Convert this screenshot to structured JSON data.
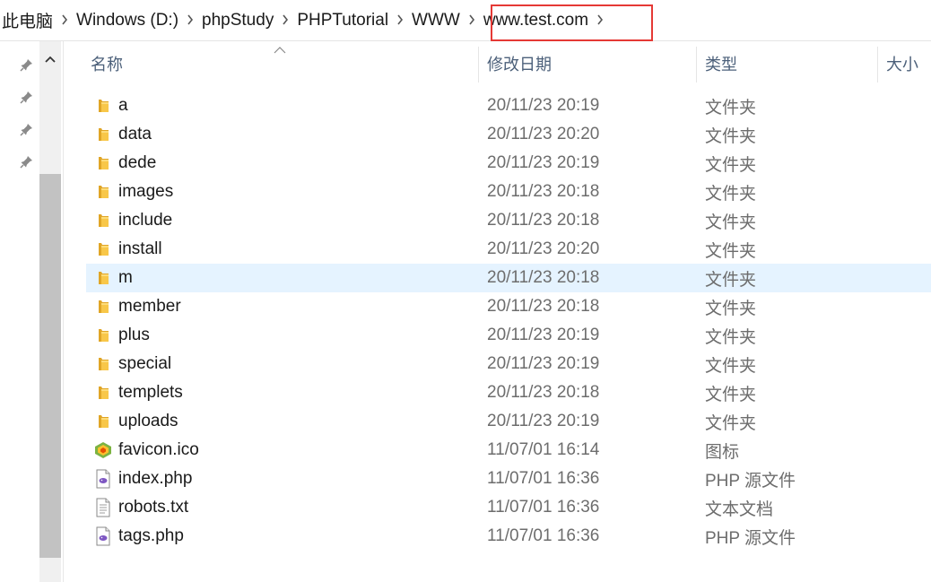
{
  "breadcrumb": {
    "items": [
      "此电脑",
      "Windows (D:)",
      "phpStudy",
      "PHPTutorial",
      "WWW",
      "www.test.com"
    ]
  },
  "columns": {
    "name": "名称",
    "date": "修改日期",
    "type": "类型",
    "size": "大小"
  },
  "files": [
    {
      "name": "a",
      "date": "20/11/23 20:19",
      "type": "文件夹",
      "icon": "folder-icon"
    },
    {
      "name": "data",
      "date": "20/11/23 20:20",
      "type": "文件夹",
      "icon": "folder-icon"
    },
    {
      "name": "dede",
      "date": "20/11/23 20:19",
      "type": "文件夹",
      "icon": "folder-icon"
    },
    {
      "name": "images",
      "date": "20/11/23 20:18",
      "type": "文件夹",
      "icon": "folder-icon"
    },
    {
      "name": "include",
      "date": "20/11/23 20:18",
      "type": "文件夹",
      "icon": "folder-icon"
    },
    {
      "name": "install",
      "date": "20/11/23 20:20",
      "type": "文件夹",
      "icon": "folder-icon"
    },
    {
      "name": "m",
      "date": "20/11/23 20:18",
      "type": "文件夹",
      "icon": "folder-icon",
      "selected": true
    },
    {
      "name": "member",
      "date": "20/11/23 20:18",
      "type": "文件夹",
      "icon": "folder-icon"
    },
    {
      "name": "plus",
      "date": "20/11/23 20:19",
      "type": "文件夹",
      "icon": "folder-icon"
    },
    {
      "name": "special",
      "date": "20/11/23 20:19",
      "type": "文件夹",
      "icon": "folder-icon"
    },
    {
      "name": "templets",
      "date": "20/11/23 20:18",
      "type": "文件夹",
      "icon": "folder-icon"
    },
    {
      "name": "uploads",
      "date": "20/11/23 20:19",
      "type": "文件夹",
      "icon": "folder-icon"
    },
    {
      "name": "favicon.ico",
      "date": "11/07/01 16:14",
      "type": "图标",
      "icon": "ico-file-icon"
    },
    {
      "name": "index.php",
      "date": "11/07/01 16:36",
      "type": "PHP 源文件",
      "icon": "php-file-icon"
    },
    {
      "name": "robots.txt",
      "date": "11/07/01 16:36",
      "type": "文本文档",
      "icon": "text-file-icon"
    },
    {
      "name": "tags.php",
      "date": "11/07/01 16:36",
      "type": "PHP 源文件",
      "icon": "php-file-icon"
    }
  ],
  "colors": {
    "selection": "#e5f3ff",
    "highlight_box": "#e53935",
    "folder": "#f8c749",
    "header_text": "#4c607a"
  }
}
